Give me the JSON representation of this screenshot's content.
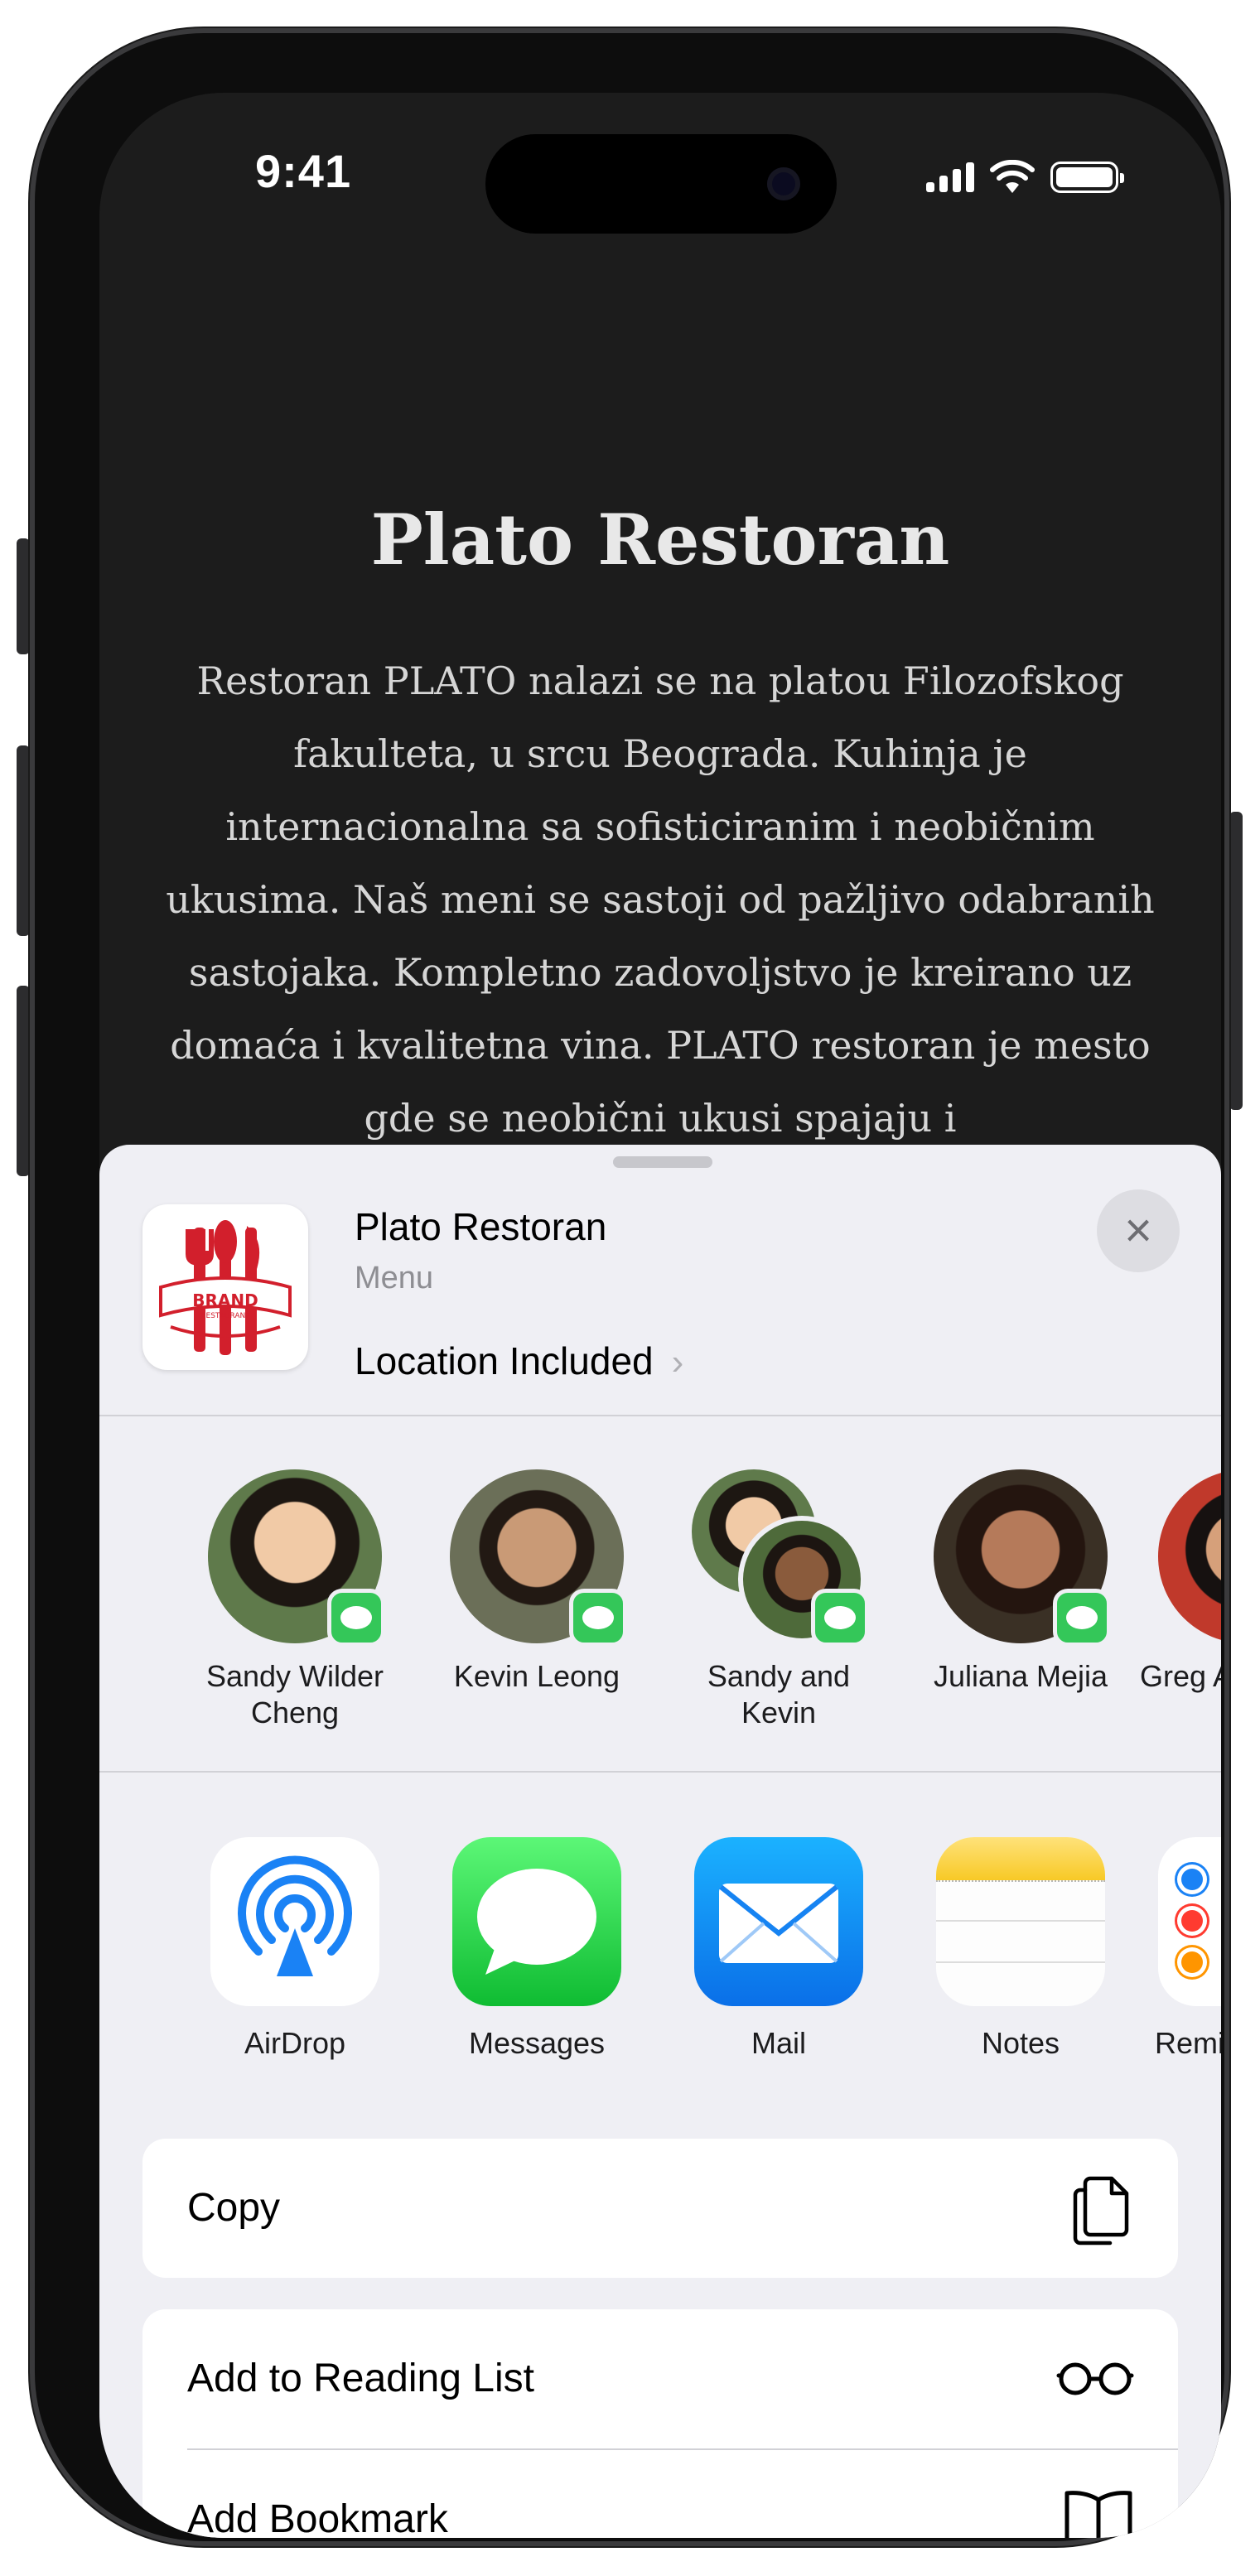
{
  "status_bar": {
    "time": "9:41"
  },
  "web": {
    "title": "Plato Restoran",
    "body": "Restoran PLATO nalazi se na platou Filozofskog fakulteta, u srcu Beograda. Kuhinja je internacionalna sa sofisticiranim i neobičnim ukusima. Naš meni se sastoji od pažljivo odabranih sastojaka. Kompletno zadovoljstvo je kreirano uz domaća i kvalitetna vina. PLATO restoran je mesto gde se neobični ukusi spajaju i"
  },
  "share_sheet": {
    "header": {
      "title": "Plato Restoran",
      "subtitle": "Menu",
      "location": "Location Included",
      "icon_text": "BRAND",
      "icon_subtext": "RESTAURANT"
    },
    "contacts": [
      {
        "name": "Sandy Wilder Cheng",
        "badge": "messages-badge-icon"
      },
      {
        "name": "Kevin Leong",
        "badge": "messages-badge-icon"
      },
      {
        "name": "Sandy and Kevin",
        "badge": "messages-badge-icon"
      },
      {
        "name": "Juliana Mejia",
        "badge": "messages-badge-icon"
      },
      {
        "name": "Greg Apo"
      }
    ],
    "apps": [
      {
        "label": "AirDrop",
        "icon": "airdrop-icon"
      },
      {
        "label": "Messages",
        "icon": "messages-icon"
      },
      {
        "label": "Mail",
        "icon": "mail-icon"
      },
      {
        "label": "Notes",
        "icon": "notes-icon"
      },
      {
        "label": "Remind",
        "icon": "reminders-icon"
      }
    ],
    "actions": [
      {
        "label": "Copy",
        "icon": "copy-icon"
      },
      {
        "label": "Add to Reading List",
        "icon": "glasses-icon"
      },
      {
        "label": "Add Bookmark",
        "icon": "book-icon"
      }
    ]
  },
  "colors": {
    "accent_green": "#34c759",
    "airdrop_blue": "#1a82f5",
    "brand_red": "#d21f2c"
  }
}
